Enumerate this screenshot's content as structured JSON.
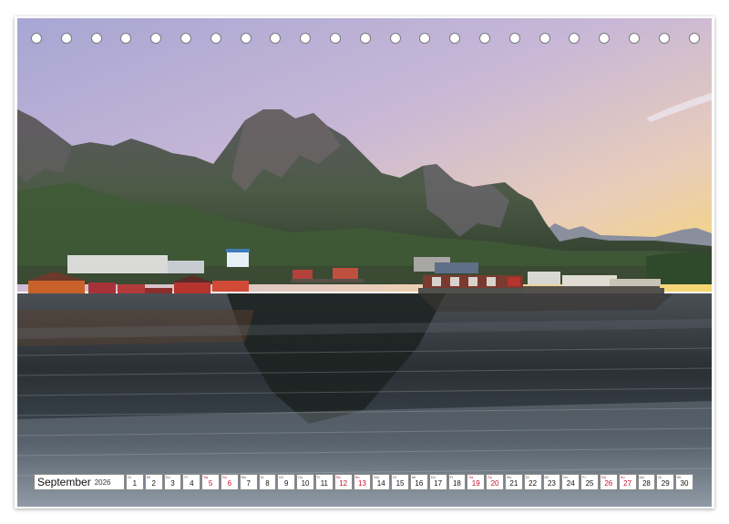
{
  "calendar": {
    "month": "September",
    "year": "2026",
    "days": [
      {
        "wd": "Di",
        "n": "1",
        "we": false
      },
      {
        "wd": "Mi",
        "n": "2",
        "we": false
      },
      {
        "wd": "Do",
        "n": "3",
        "we": false
      },
      {
        "wd": "Fr",
        "n": "4",
        "we": false
      },
      {
        "wd": "Sa",
        "n": "5",
        "we": true
      },
      {
        "wd": "So",
        "n": "6",
        "we": true
      },
      {
        "wd": "Mo",
        "n": "7",
        "we": false
      },
      {
        "wd": "Di",
        "n": "8",
        "we": false
      },
      {
        "wd": "Mi",
        "n": "9",
        "we": false
      },
      {
        "wd": "Do",
        "n": "10",
        "we": false
      },
      {
        "wd": "Fr",
        "n": "11",
        "we": false
      },
      {
        "wd": "Sa",
        "n": "12",
        "we": true
      },
      {
        "wd": "So",
        "n": "13",
        "we": true
      },
      {
        "wd": "Mo",
        "n": "14",
        "we": false
      },
      {
        "wd": "Di",
        "n": "15",
        "we": false
      },
      {
        "wd": "Mi",
        "n": "16",
        "we": false
      },
      {
        "wd": "Do",
        "n": "17",
        "we": false
      },
      {
        "wd": "Fr",
        "n": "18",
        "we": false
      },
      {
        "wd": "Sa",
        "n": "19",
        "we": true
      },
      {
        "wd": "So",
        "n": "20",
        "we": true
      },
      {
        "wd": "Mo",
        "n": "21",
        "we": false
      },
      {
        "wd": "Di",
        "n": "22",
        "we": false
      },
      {
        "wd": "Mi",
        "n": "23",
        "we": false
      },
      {
        "wd": "Do",
        "n": "24",
        "we": false
      },
      {
        "wd": "Fr",
        "n": "25",
        "we": false
      },
      {
        "wd": "Sa",
        "n": "26",
        "we": true
      },
      {
        "wd": "So",
        "n": "27",
        "we": true
      },
      {
        "wd": "Mo",
        "n": "28",
        "we": false
      },
      {
        "wd": "Di",
        "n": "29",
        "we": false
      },
      {
        "wd": "Mi",
        "n": "30",
        "we": false
      }
    ]
  },
  "colors": {
    "weekend": "#c8102e",
    "sky_top": "#a9a5cf",
    "sky_glow": "#f6d77a",
    "mountain": "#4a5446",
    "water": "#2c3336"
  }
}
